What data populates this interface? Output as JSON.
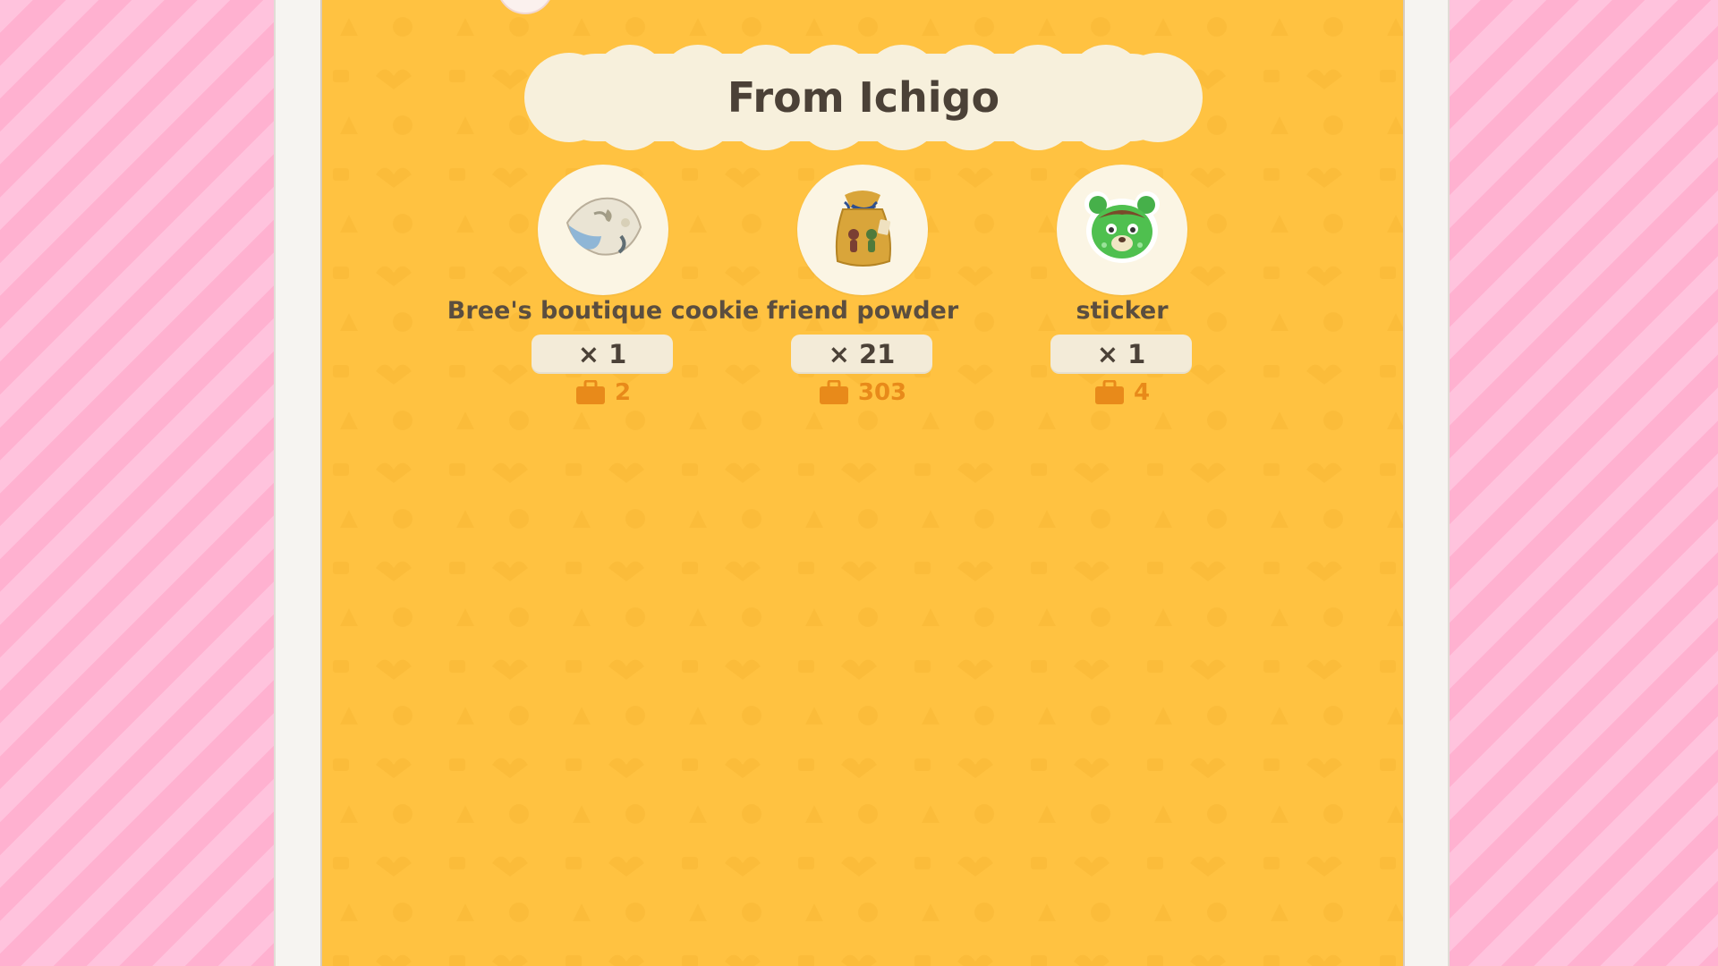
{
  "panel": {
    "title": "From Ichigo",
    "background_color": "#ffc241"
  },
  "items": [
    {
      "name": "Bree's boutique cookie",
      "quantity": "× 1",
      "bag_count": "2",
      "icon": "cookie-icon"
    },
    {
      "name": "friend powder",
      "quantity": "× 21",
      "bag_count": "303",
      "icon": "friend-powder-sack-icon"
    },
    {
      "name": "sticker",
      "quantity": "× 1",
      "bag_count": "4",
      "icon": "bear-sticker-icon"
    }
  ],
  "colors": {
    "bag_count": "#e88a1a",
    "background_stripes": [
      "#ffc3dd",
      "#ffb1d0"
    ]
  }
}
